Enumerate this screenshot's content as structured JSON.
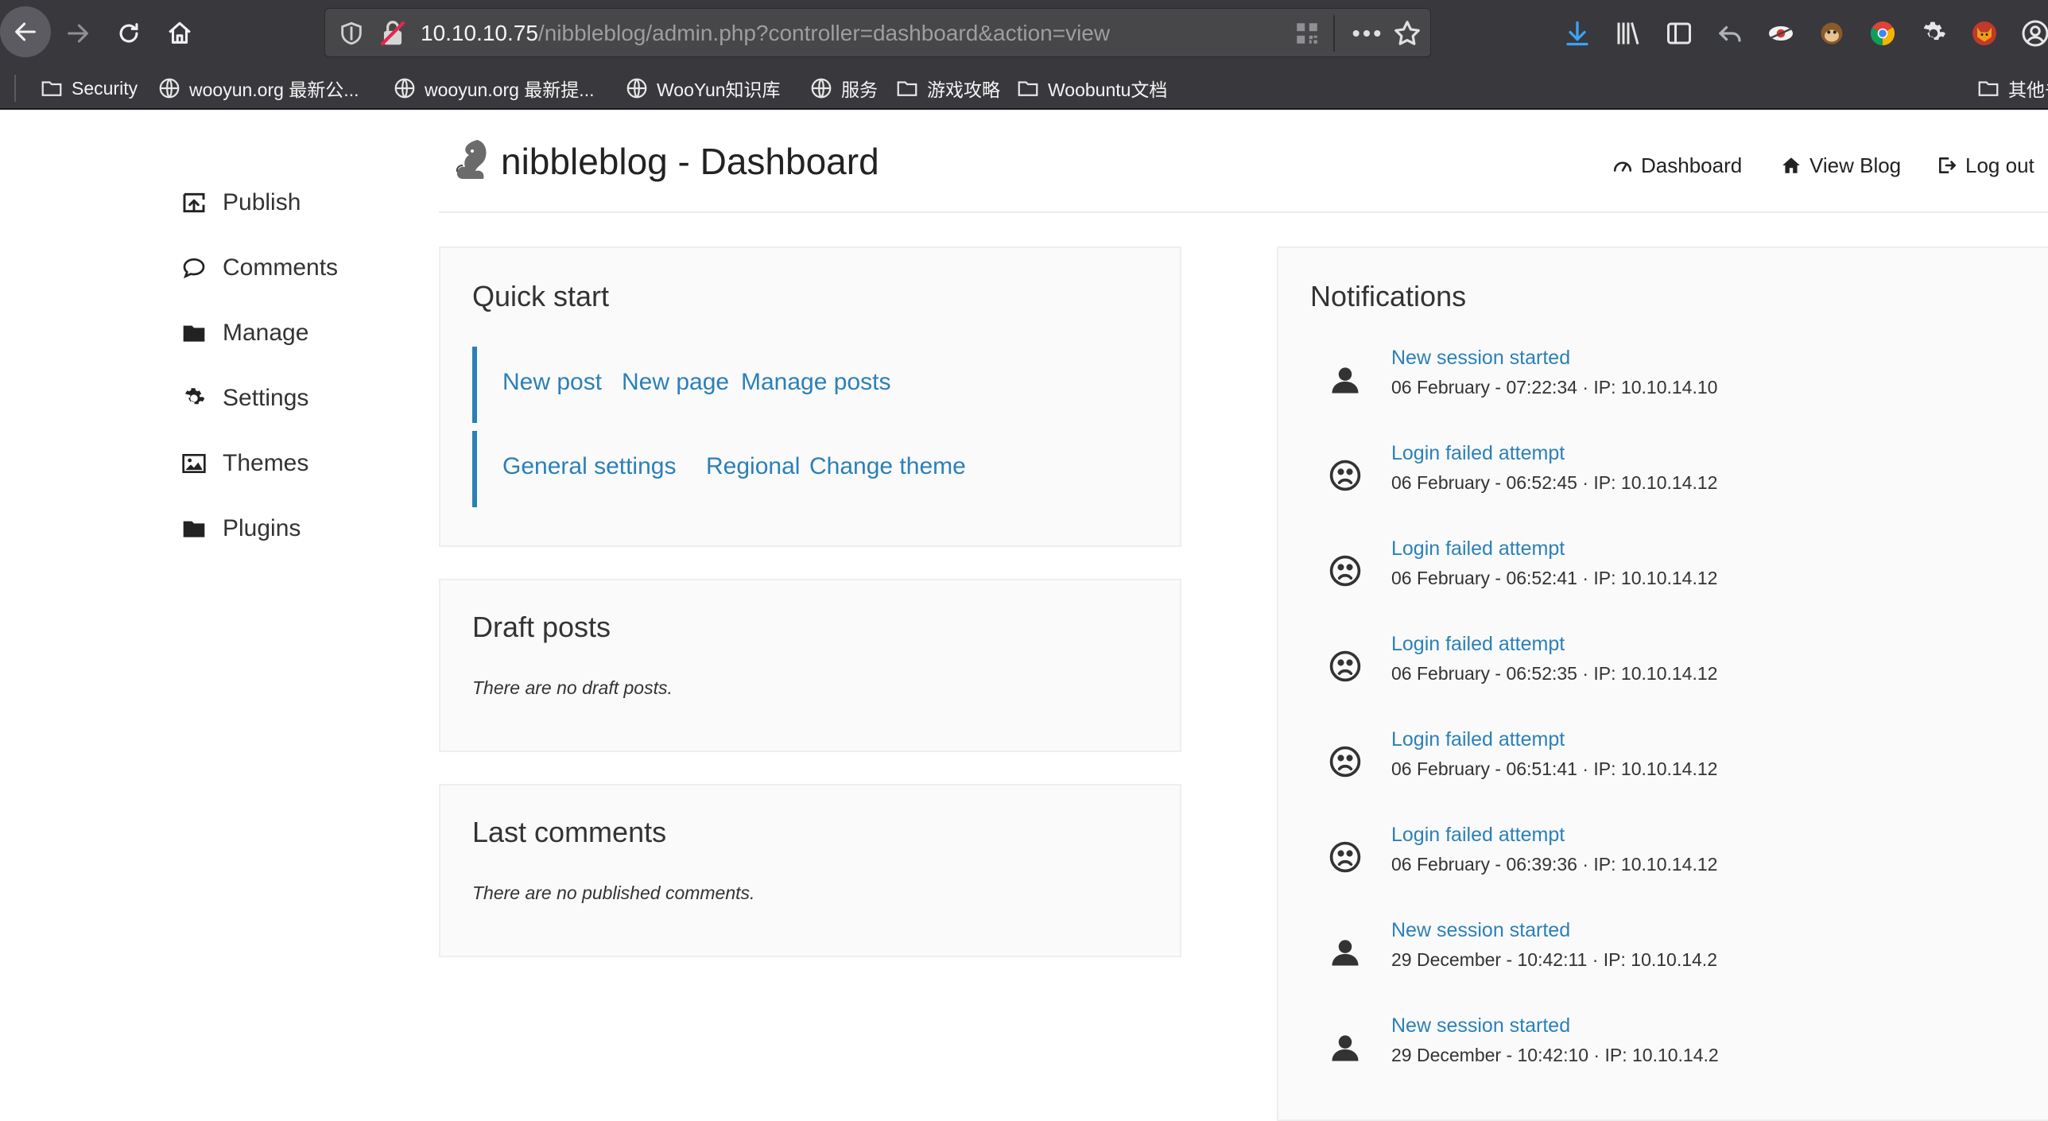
{
  "browser": {
    "url_host": "10.10.10.75",
    "url_path": "/nibbleblog/admin.php?controller=dashboard&action=view"
  },
  "bookmarks": [
    {
      "label": "Security",
      "icon": "folder-icon"
    },
    {
      "label": "wooyun.org 最新公...",
      "icon": "globe-icon"
    },
    {
      "label": "wooyun.org 最新提...",
      "icon": "globe-icon"
    },
    {
      "label": "WooYun知识库",
      "icon": "globe-icon"
    },
    {
      "label": "服务",
      "icon": "globe-icon"
    },
    {
      "label": "游戏攻略",
      "icon": "folder-icon"
    },
    {
      "label": "Woobuntu文档",
      "icon": "folder-icon"
    },
    {
      "label": "其他书",
      "icon": "folder-icon"
    }
  ],
  "header": {
    "title": "nibbleblog - Dashboard",
    "links": {
      "dashboard": "Dashboard",
      "view_blog": "View Blog",
      "logout": "Log out"
    }
  },
  "sidebar": {
    "items": [
      {
        "label": "Publish"
      },
      {
        "label": "Comments"
      },
      {
        "label": "Manage"
      },
      {
        "label": "Settings"
      },
      {
        "label": "Themes"
      },
      {
        "label": "Plugins"
      }
    ]
  },
  "quick_start": {
    "title": "Quick start",
    "row1": [
      "New post",
      "New page",
      "Manage posts"
    ],
    "row2": [
      "General settings",
      "Regional",
      "Change theme"
    ]
  },
  "draft_posts": {
    "title": "Draft posts",
    "empty": "There are no draft posts."
  },
  "last_comments": {
    "title": "Last comments",
    "empty": "There are no published comments."
  },
  "notifications": {
    "title": "Notifications",
    "items": [
      {
        "title": "New session started",
        "meta": "06 February - 07:22:34 · IP: 10.10.14.10",
        "icon": "user-icon"
      },
      {
        "title": "Login failed attempt",
        "meta": "06 February - 06:52:45 · IP: 10.10.14.12",
        "icon": "sad-face-icon"
      },
      {
        "title": "Login failed attempt",
        "meta": "06 February - 06:52:41 · IP: 10.10.14.12",
        "icon": "sad-face-icon"
      },
      {
        "title": "Login failed attempt",
        "meta": "06 February - 06:52:35 · IP: 10.10.14.12",
        "icon": "sad-face-icon"
      },
      {
        "title": "Login failed attempt",
        "meta": "06 February - 06:51:41 · IP: 10.10.14.12",
        "icon": "sad-face-icon"
      },
      {
        "title": "Login failed attempt",
        "meta": "06 February - 06:39:36 · IP: 10.10.14.12",
        "icon": "sad-face-icon"
      },
      {
        "title": "New session started",
        "meta": "29 December - 10:42:11 · IP: 10.10.14.2",
        "icon": "user-icon"
      },
      {
        "title": "New session started",
        "meta": "29 December - 10:42:10 · IP: 10.10.14.2",
        "icon": "user-icon"
      }
    ]
  },
  "colors": {
    "link": "#2a80b9",
    "chrome": "#38383d"
  }
}
